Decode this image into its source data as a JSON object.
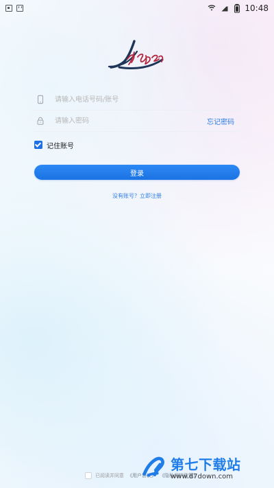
{
  "status_bar": {
    "time": "10:48"
  },
  "brand": {
    "logo_text": "lkyzn"
  },
  "login": {
    "phone_placeholder": "请输入电话号码/账号",
    "password_placeholder": "请输入密码",
    "forgot_password": "忘记密码",
    "remember_label": "记住账号",
    "login_button": "登录",
    "register_link": "没有账号？立即注册"
  },
  "agreement": {
    "text": "已阅读并同意",
    "user_agreement": "《用户协议》",
    "privacy_policy": "《隐私保护政策》"
  },
  "watermark": {
    "main": "第七下载站",
    "sub": "www.d7down.com"
  },
  "colors": {
    "accent": "#1C73E3",
    "link": "#2F7EE6",
    "logo_dark": "#1E3557",
    "logo_red": "#B2253D"
  },
  "icons": {
    "sim": "sim-icon",
    "app": "a-box-icon",
    "wifi": "wifi-icon",
    "signal": "signal-icon",
    "battery": "battery-icon",
    "phone": "phone-icon",
    "lock": "lock-icon",
    "checkbox": "checked-checkbox-icon",
    "watermark_logo": "d7-logo-icon"
  }
}
